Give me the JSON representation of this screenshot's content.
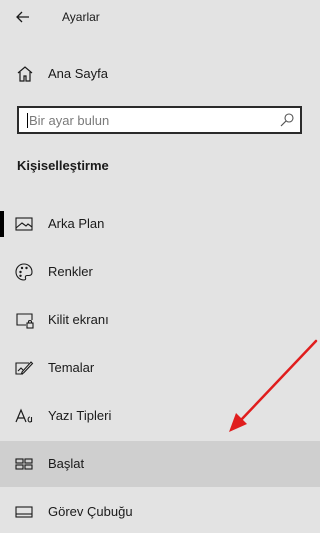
{
  "header": {
    "title": "Ayarlar",
    "back_icon": "back-arrow-icon"
  },
  "home": {
    "label": "Ana Sayfa",
    "icon": "home-icon"
  },
  "search": {
    "placeholder": "Bir ayar bulun",
    "icon": "search-icon"
  },
  "section": {
    "title": "Kişiselleştirme"
  },
  "nav": {
    "items": [
      {
        "label": "Arka Plan",
        "icon": "picture-icon",
        "active": true
      },
      {
        "label": "Renkler",
        "icon": "palette-icon"
      },
      {
        "label": "Kilit ekranı",
        "icon": "lock-screen-icon"
      },
      {
        "label": "Temalar",
        "icon": "themes-icon"
      },
      {
        "label": "Yazı Tipleri",
        "icon": "fonts-icon"
      },
      {
        "label": "Başlat",
        "icon": "start-tiles-icon",
        "highlighted": true
      },
      {
        "label": "Görev Çubuğu",
        "icon": "taskbar-icon"
      }
    ]
  },
  "annotation": {
    "color": "#e01e1e"
  },
  "colors": {
    "background": "#e3e3e3",
    "selected_row": "#cfcfcf"
  }
}
